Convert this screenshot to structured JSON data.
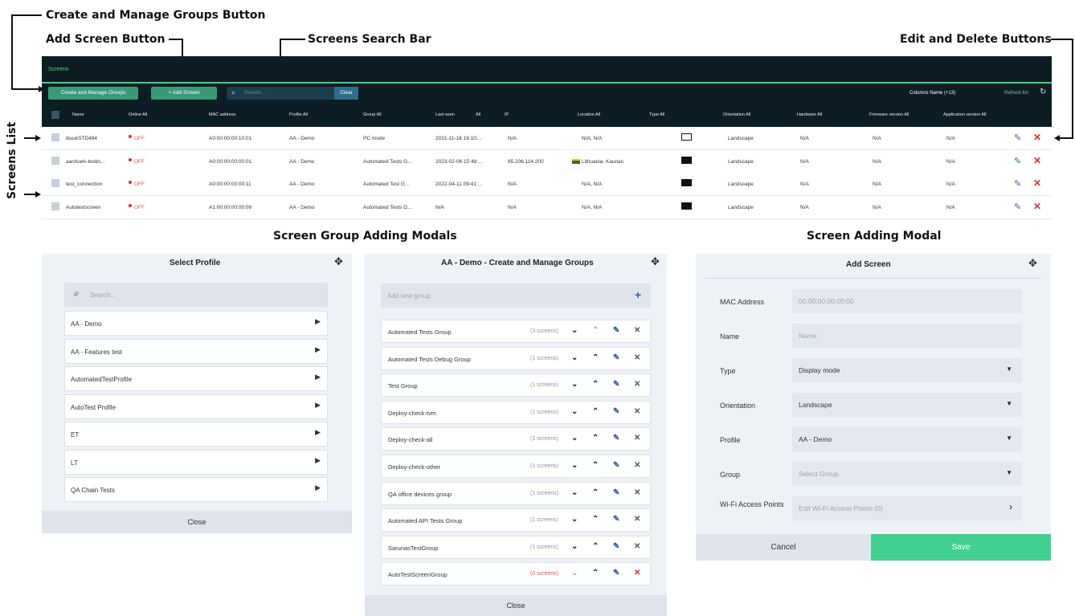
{
  "annotations": {
    "create_manage": "Create and Manage Groups Button",
    "add_screen": "Add Screen Button",
    "search_bar": "Screens Search Bar",
    "edit_delete": "Edit and Delete Buttons",
    "screens_list": "Screens List",
    "group_modals": "Screen Group Adding Modals",
    "screen_modal": "Screen Adding Modal"
  },
  "screens": {
    "title": "Screens",
    "create_manage_btn": "Create and Manage Groups",
    "add_screen_btn": "+ Add Screen",
    "search_placeholder": "Search...",
    "clear_btn": "Clear",
    "columns_text": "Columns  Name (+13)",
    "refresh_text": "Refresh list",
    "headers": [
      "Name",
      "Online All",
      "MAC address",
      "Profile All",
      "Group All",
      "Last seen",
      "All",
      "IP",
      "Location All",
      "Type All",
      "Orientation All",
      "Hardware All",
      "Firmware version All",
      "Application version All"
    ],
    "rows": [
      {
        "name": "tiiuukSTD484",
        "online": "OFF",
        "mac": "A0:00:00:00:10:01",
        "profile": "AA - Demo",
        "group": "PC mode",
        "last_seen": "2021-11-18 16:10:...",
        "ip": "N/A",
        "location": "N/A, N/A",
        "orientation": "Landscape",
        "hardware": "N/A",
        "firmware": "N/A",
        "app": "N/A"
      },
      {
        "name": "aardvark-testin...",
        "online": "OFF",
        "mac": "A0:00:00:00:00:01",
        "profile": "AA - Demo",
        "group": "Automated Tests G...",
        "last_seen": "2023-02-06 15:48:...",
        "ip": "85.206.114.200",
        "location": "Lithuania, Kaunas",
        "orientation": "Landscape",
        "hardware": "N/A",
        "firmware": "N/A",
        "app": "N/A"
      },
      {
        "name": "test_connection",
        "online": "OFF",
        "mac": "A0:00:00:00:00:11",
        "profile": "AA - Demo",
        "group": "Automated Test G...",
        "last_seen": "2022-04-11 09:41:...",
        "ip": "N/A",
        "location": "N/A, N/A",
        "orientation": "Landscape",
        "hardware": "N/A",
        "firmware": "N/A",
        "app": "N/A"
      },
      {
        "name": "Autotestscreen",
        "online": "OFF",
        "mac": "A1:00:00:00:00:09",
        "profile": "AA - Demo",
        "group": "Automated Tests G...",
        "last_seen": "N/A",
        "ip": "N/A",
        "location": "N/A, N/A",
        "orientation": "Landscape",
        "hardware": "N/A",
        "firmware": "N/A",
        "app": "N/A"
      }
    ]
  },
  "select_profile": {
    "title": "Select Profile",
    "search_placeholder": "Search...",
    "items": [
      "AA - Demo",
      "AA - Features test",
      "AutomatedTestProfile",
      "AutoTest Profile",
      "ET",
      "LT",
      "QA Chain Tests"
    ],
    "close": "Close"
  },
  "groups_modal": {
    "title": "AA - Demo - Create and Manage Groups",
    "add_placeholder": "Add new group",
    "groups": [
      {
        "name": "Automated Tests Group",
        "count": "(3 screens)"
      },
      {
        "name": "Automated Tests Debug Group",
        "count": "(1 screens)"
      },
      {
        "name": "Test Group",
        "count": "(1 screens)"
      },
      {
        "name": "Deploy-check-tvm",
        "count": "(1 screens)"
      },
      {
        "name": "Deploy-check-all",
        "count": "(1 screens)"
      },
      {
        "name": "Deploy-check-other",
        "count": "(1 screens)"
      },
      {
        "name": "QA office devices group",
        "count": "(1 screens)"
      },
      {
        "name": "Automated API Tests Group",
        "count": "(1 screens)"
      },
      {
        "name": "SarunasTestGroup",
        "count": "(1 screens)"
      },
      {
        "name": "AutoTestScreenGroup",
        "count": "(0 screens)"
      }
    ],
    "close": "Close"
  },
  "add_screen": {
    "title": "Add Screen",
    "fields": [
      {
        "label": "MAC Address",
        "value": "00:00:00:00:00:00",
        "placeholder": true,
        "dropdown": false
      },
      {
        "label": "Name",
        "value": "Name",
        "placeholder": true,
        "dropdown": false
      },
      {
        "label": "Type",
        "value": "Display mode",
        "placeholder": false,
        "dropdown": true
      },
      {
        "label": "Orientation",
        "value": "Landscape",
        "placeholder": false,
        "dropdown": true
      },
      {
        "label": "Profile",
        "value": "AA - Demo",
        "placeholder": false,
        "dropdown": true
      },
      {
        "label": "Group",
        "value": "Select Group",
        "placeholder": true,
        "dropdown": true
      },
      {
        "label": "Wi-Fi Access Points",
        "value": "Edit Wi-Fi Access Points (0)",
        "placeholder": true,
        "dropdown": false
      }
    ],
    "cancel": "Cancel",
    "save": "Save"
  },
  "colors": {
    "dark": "#0c1d23",
    "accent": "#3fd18c",
    "danger": "#e02c2c",
    "edit": "#2f5fa8"
  }
}
